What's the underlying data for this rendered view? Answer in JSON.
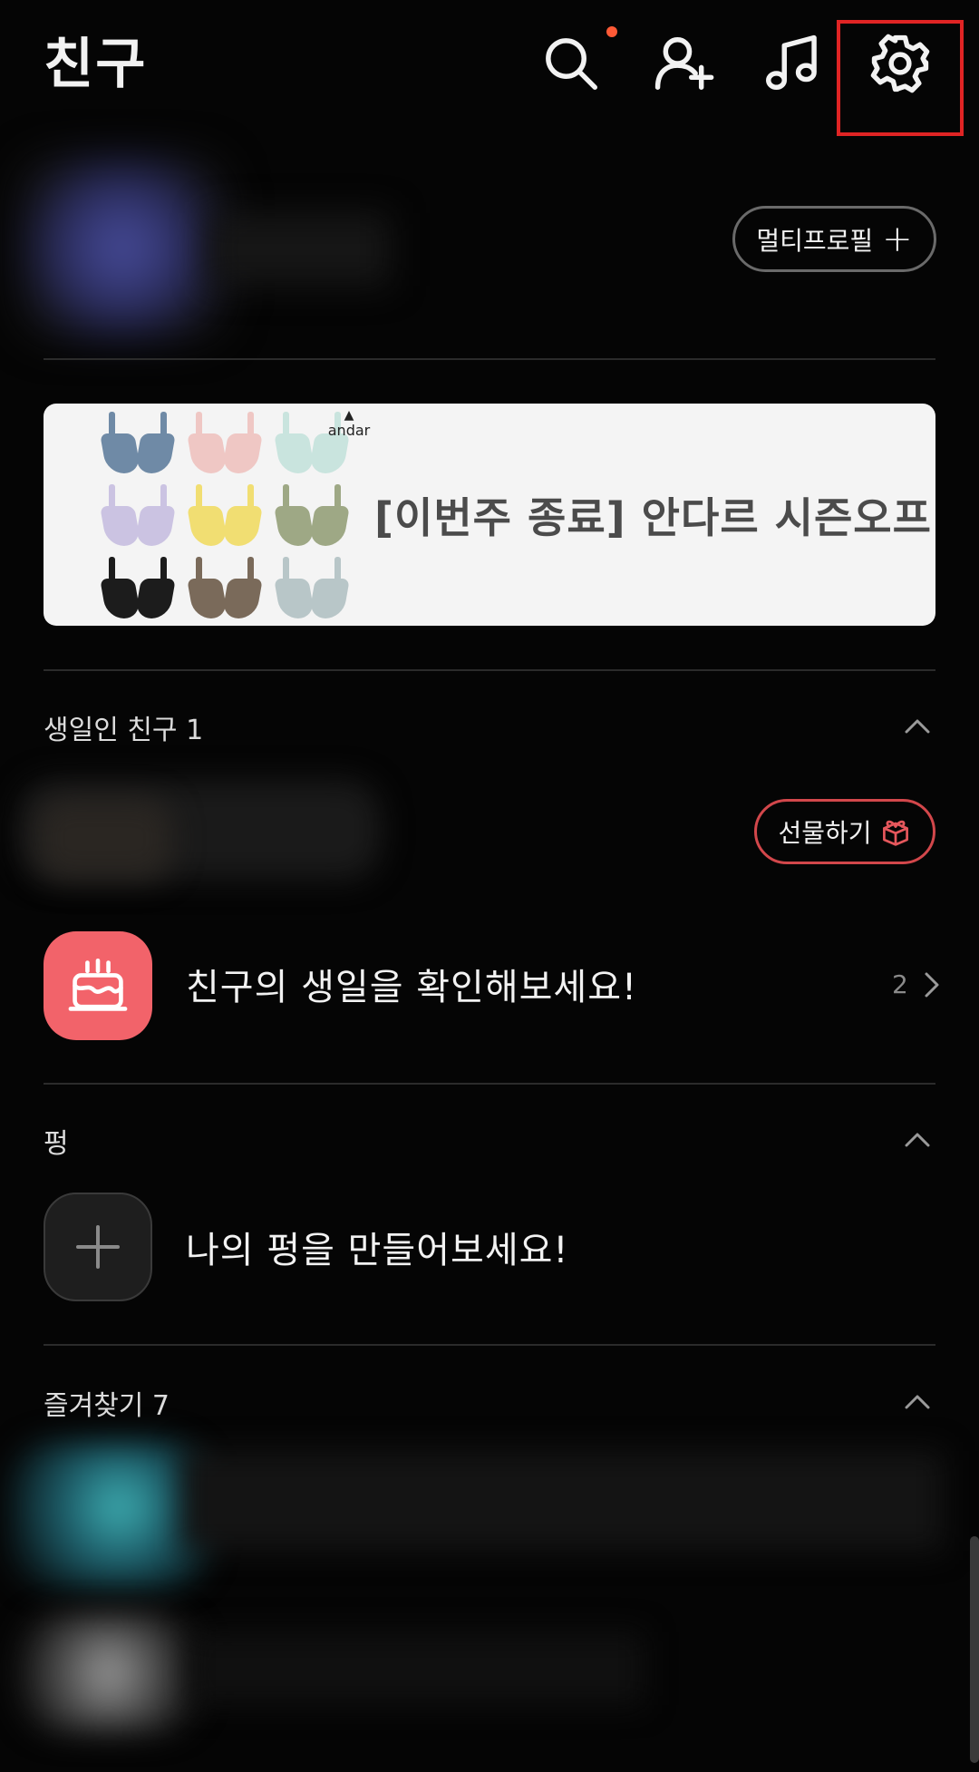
{
  "header": {
    "title": "친구",
    "icons": [
      "search-icon",
      "add-friend-icon",
      "music-icon",
      "settings-icon"
    ],
    "notification_dot_color": "#ff5a36",
    "highlight_color": "#e02424"
  },
  "profile": {
    "multi_profile_label": "멀티프로필"
  },
  "ad": {
    "text": "[이번주 종료] 안다르 시즌오프",
    "brand": "andar",
    "product_colors": [
      "#6f8aa6",
      "#efc7c4",
      "#c9e4de",
      "#cbc3e2",
      "#f1de72",
      "#9ea885",
      "#1c1c1c",
      "#7a6a5a",
      "#b8c6c8"
    ]
  },
  "birthday": {
    "label": "생일인 친구 1",
    "gift_label": "선물하기",
    "check_text": "친구의 생일을 확인해보세요!",
    "count": "2"
  },
  "pung": {
    "label": "펑",
    "create_text": "나의 펑을 만들어보세요!"
  },
  "favorites": {
    "label": "즐겨찾기 7"
  },
  "colors": {
    "background": "#050505",
    "cake_tile": "#f2636a",
    "gift_border": "#d2474b"
  }
}
